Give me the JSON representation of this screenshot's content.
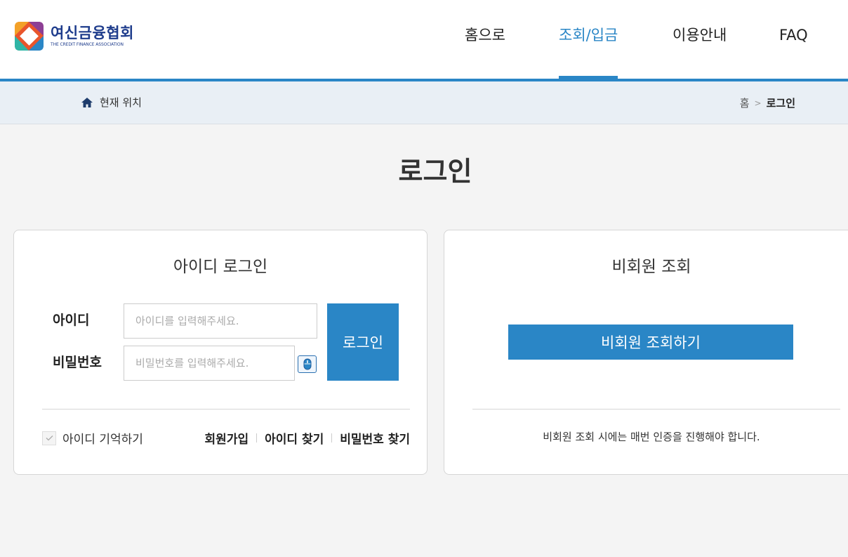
{
  "header": {
    "logo": {
      "name_ko": "여신금융협회",
      "name_en": "THE CREDIT FINANCE ASSOCIATION"
    },
    "nav": [
      {
        "label": "홈으로",
        "active": false
      },
      {
        "label": "조회/입금",
        "active": true
      },
      {
        "label": "이용안내",
        "active": false
      },
      {
        "label": "FAQ",
        "active": false
      }
    ]
  },
  "location": {
    "label": "현재 위치",
    "icon": "home-icon",
    "breadcrumb": {
      "home": "홈",
      "separator": ">",
      "current": "로그인"
    }
  },
  "page": {
    "title": "로그인"
  },
  "id_login": {
    "title": "아이디 로그인",
    "id_label": "아이디",
    "id_placeholder": "아이디를 입력해주세요.",
    "pw_label": "비밀번호",
    "pw_placeholder": "비밀번호를 입력해주세요.",
    "mouse_icon": "mouse-icon",
    "login_button": "로그인",
    "remember_label": "아이디 기억하기",
    "remember_checked": false,
    "links": {
      "signup": "회원가입",
      "find_id": "아이디 찾기",
      "find_pw": "비밀번호 찾기"
    }
  },
  "guest": {
    "title": "비회원 조회",
    "button": "비회원 조회하기",
    "notice": "비회원 조회 시에는 매번 인증을 진행해야 합니다."
  },
  "colors": {
    "accent": "#2a86c6",
    "brand_text": "#1e3c8c",
    "subbar_bg": "#e9eff5",
    "page_bg": "#f4f4f4"
  }
}
